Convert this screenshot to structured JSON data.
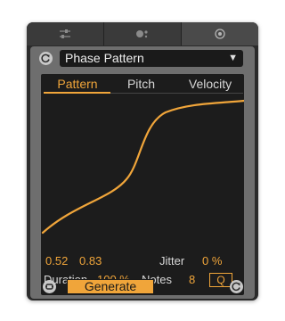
{
  "top_tabs": [
    {
      "icon": "sliders-icon"
    },
    {
      "icon": "dots-icon"
    },
    {
      "icon": "target-icon"
    }
  ],
  "preset": {
    "value": "Phase Pattern",
    "dropdown_icon": "triangle-down-icon"
  },
  "subtabs": [
    {
      "label": "Pattern"
    },
    {
      "label": "Pitch"
    },
    {
      "label": "Velocity"
    }
  ],
  "params": {
    "start": "0.52",
    "end": "0.83",
    "jitter_label": "Jitter",
    "jitter_value": "0 %",
    "duration_label": "Duration",
    "duration_value": "100 %",
    "notes_label": "Notes",
    "notes_value": "8",
    "quantize_label": "Q"
  },
  "footer": {
    "generate_label": "Generate"
  },
  "colors": {
    "accent": "#f0a53a",
    "background": "#1c1c1c",
    "panel": "#6e6e6e"
  }
}
